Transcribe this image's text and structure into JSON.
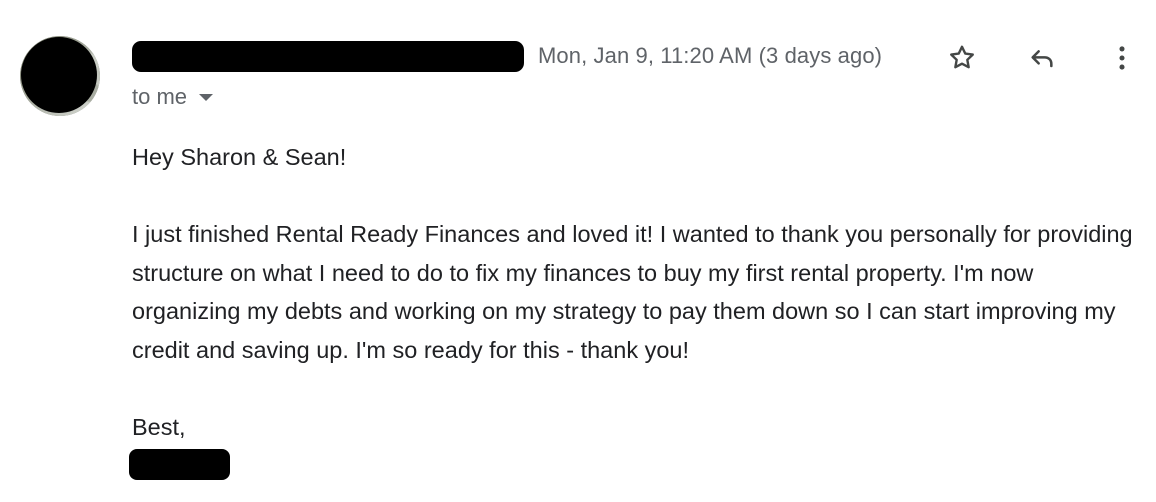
{
  "email": {
    "date": "Mon, Jan 9, 11:20 AM (3 days ago)",
    "recipient_label": "to me",
    "greeting": "Hey Sharon & Sean!",
    "paragraph": "I just finished Rental Ready Finances and loved it! I wanted to thank you personally for providing structure on what I need to do to fix my finances to buy my first rental property. I'm now organizing my debts and working on my strategy to pay them down so I can start improving my credit and saving up. I'm so ready for this - thank you!",
    "signoff": "Best,"
  },
  "icons": {
    "star": "star-icon",
    "reply": "reply-icon",
    "more": "more-vert-icon",
    "caret": "caret-down-icon"
  },
  "colors": {
    "text": "#202124",
    "secondary_text": "#5f6368",
    "redaction": "#000000"
  }
}
